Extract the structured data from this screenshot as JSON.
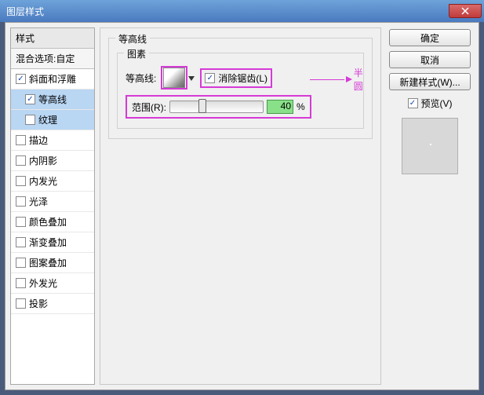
{
  "window": {
    "title": "图层样式"
  },
  "sidebar": {
    "header": "样式",
    "subheader": "混合选项:自定",
    "items": [
      {
        "label": "斜面和浮雕",
        "checked": true,
        "indent": false,
        "selected": false
      },
      {
        "label": "等高线",
        "checked": true,
        "indent": true,
        "selected": true
      },
      {
        "label": "纹理",
        "checked": false,
        "indent": true,
        "selected": true
      },
      {
        "label": "描边",
        "checked": false,
        "indent": false,
        "selected": false
      },
      {
        "label": "内阴影",
        "checked": false,
        "indent": false,
        "selected": false
      },
      {
        "label": "内发光",
        "checked": false,
        "indent": false,
        "selected": false
      },
      {
        "label": "光泽",
        "checked": false,
        "indent": false,
        "selected": false
      },
      {
        "label": "颜色叠加",
        "checked": false,
        "indent": false,
        "selected": false
      },
      {
        "label": "渐变叠加",
        "checked": false,
        "indent": false,
        "selected": false
      },
      {
        "label": "图案叠加",
        "checked": false,
        "indent": false,
        "selected": false
      },
      {
        "label": "外发光",
        "checked": false,
        "indent": false,
        "selected": false
      },
      {
        "label": "投影",
        "checked": false,
        "indent": false,
        "selected": false
      }
    ]
  },
  "center": {
    "group_title": "等高线",
    "inner_title": "图素",
    "contour_label": "等高线:",
    "antialias_label": "消除锯齿(L)",
    "antialias_checked": true,
    "range_label": "范围(R):",
    "range_value": "40",
    "range_unit": "%",
    "annotation": "半圆"
  },
  "right": {
    "ok": "确定",
    "cancel": "取消",
    "newstyle": "新建样式(W)...",
    "preview_label": "预览(V)",
    "preview_checked": true
  }
}
